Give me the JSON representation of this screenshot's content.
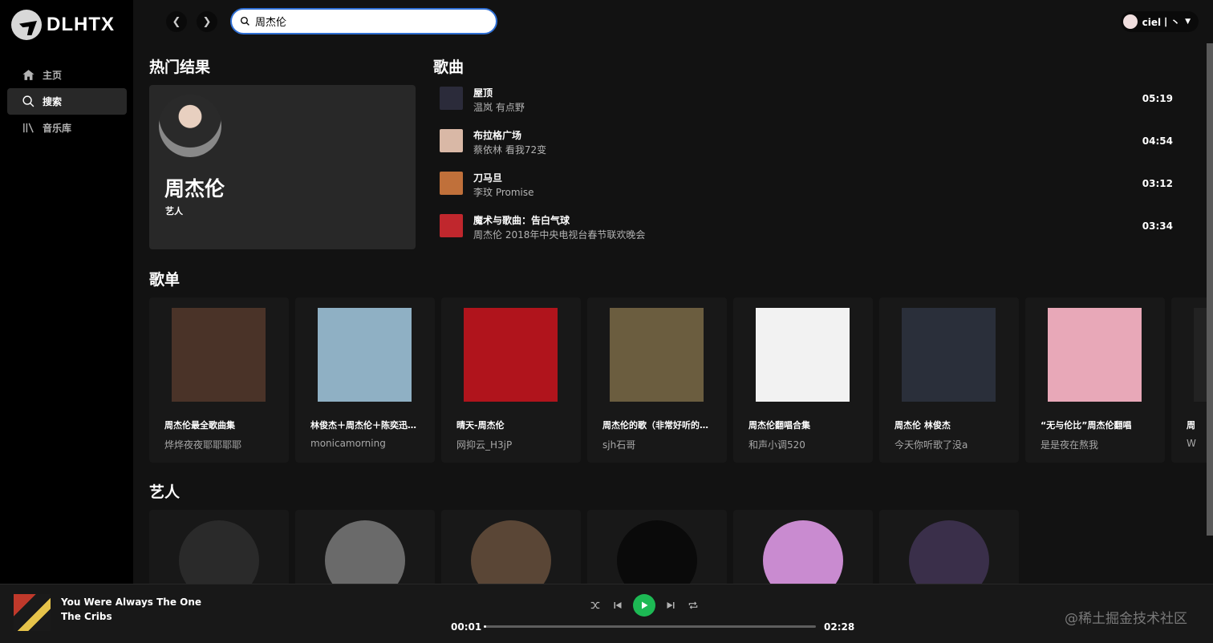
{
  "app": {
    "logo_text": "DLHTX"
  },
  "sidebar": {
    "items": [
      {
        "label": "主页",
        "icon": "home-icon",
        "active": false
      },
      {
        "label": "搜索",
        "icon": "search-icon",
        "active": true
      },
      {
        "label": "音乐库",
        "icon": "library-icon",
        "active": false
      }
    ]
  },
  "topbar": {
    "search_value": "周杰伦",
    "user_name": "ciel丨丶"
  },
  "sections": {
    "top_result": "热门结果",
    "songs": "歌曲",
    "playlists": "歌单",
    "artists": "艺人"
  },
  "top_result": {
    "name": "周杰伦",
    "type": "艺人"
  },
  "songs": [
    {
      "title": "屋顶",
      "artist": "温岚 有点野",
      "duration": "05:19",
      "cover_color": "#2b2b3a"
    },
    {
      "title": "布拉格广场",
      "artist": "蔡依林 看我72变",
      "duration": "04:54",
      "cover_color": "#d9b8a6"
    },
    {
      "title": "刀马旦",
      "artist": "李玟 Promise",
      "duration": "03:12",
      "cover_color": "#c0703a"
    },
    {
      "title": "魔术与歌曲：告白气球",
      "artist": "周杰伦 2018年中央电视台春节联欢晚会",
      "duration": "03:34",
      "cover_color": "#c0272d"
    }
  ],
  "playlists": [
    {
      "title": "周杰伦最全歌曲集",
      "creator": "烨烨夜夜耶耶耶耶",
      "cover_color": "#4a3328"
    },
    {
      "title": "林俊杰＋周杰伦＋陈奕迅＋薛之谦",
      "creator": "monicamorning",
      "cover_color": "#8fb0c4"
    },
    {
      "title": "晴天-周杰伦",
      "creator": "网抑云_H3jP",
      "cover_color": "#b0141c"
    },
    {
      "title": "周杰伦的歌（非常好听的歌）",
      "creator": "sjh石哥",
      "cover_color": "#6b5d3f"
    },
    {
      "title": "周杰伦翻唱合集",
      "creator": "和声小调520",
      "cover_color": "#f2f2f2"
    },
    {
      "title": "周杰伦 林俊杰",
      "creator": "今天你听歌了没a",
      "cover_color": "#2a2f3a"
    },
    {
      "title": "“无与伦比”周杰伦翻唱",
      "creator": "是是夜在熬我",
      "cover_color": "#e8a8b8"
    },
    {
      "title": "周",
      "creator": "W",
      "cover_color": "#222222"
    }
  ],
  "artists": [
    {
      "cover_color": "#2a2a2a"
    },
    {
      "cover_color": "#6a6a6a"
    },
    {
      "cover_color": "#5a4636"
    },
    {
      "cover_color": "#0a0a0a"
    },
    {
      "cover_color": "#c98bd0"
    },
    {
      "cover_color": "#3a2f4a"
    }
  ],
  "player": {
    "track_title": "You Were Always The One",
    "track_artist": "The Cribs",
    "current_time": "00:01",
    "total_time": "02:28",
    "progress_fraction": 0.007
  },
  "watermark": "@稀土掘金技术社区",
  "colors": {
    "accent": "#1db954",
    "search_border": "#2f6fd4"
  }
}
